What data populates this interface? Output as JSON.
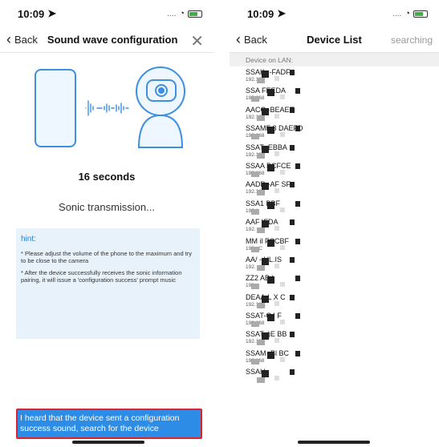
{
  "left": {
    "status": {
      "time": "10:09"
    },
    "nav": {
      "back_label": "Back",
      "title": "Sound wave configuration",
      "close_glyph": "✕"
    },
    "countdown": "16 seconds",
    "status_text": "Sonic transmission...",
    "hint": {
      "title": "hint:",
      "items": [
        "* Please adjust the volume of the phone to the maximum and try to be close to the camera",
        "* After the device successfully receives the sonic information pairing, it will issue a 'configuration success' prompt music"
      ]
    },
    "confirm_button": "I heard that the device sent a configuration success sound, search for the device"
  },
  "right": {
    "status": {
      "time": "10:09"
    },
    "nav": {
      "back_label": "Back",
      "title": "Device List",
      "right_label": "searching"
    },
    "section_header": "Device on LAN:",
    "devices": [
      {
        "name": "SSAK-       -FADF",
        "ip": "192.168"
      },
      {
        "name": "SSA        FEEDA",
        "ip": "192.168"
      },
      {
        "name": "AACC        -BEAEE",
        "ip": "192.168"
      },
      {
        "name": "SSAMF 3      DAEFD",
        "ip": "192.168"
      },
      {
        "name": "SSAT-        EBBA",
        "ip": "192.168"
      },
      {
        "name": "SSAA        BCFCE",
        "ip": "192.168"
      },
      {
        "name": "AADD        -AF SF",
        "ip": "192.16"
      },
      {
        "name": "SSA1         BBF",
        "ip": "192.1"
      },
      {
        "name": "AAF          \\FDA",
        "ip": "192."
      },
      {
        "name": "MM  il      FCCBF",
        "ip": "192.  :C"
      },
      {
        "name": "AA/  -      UL.IS",
        "ip": "192."
      },
      {
        "name": "ZZ2          AB )",
        "ip": "192."
      },
      {
        "name": "DEAA-L        X  C",
        "ip": "192.168."
      },
      {
        "name": "SSAT-C       I  F",
        "ip": "192.168"
      },
      {
        "name": "SSAT-        )E BB",
        "ip": "192.168"
      },
      {
        "name": "SSAM         -Bl BC",
        "ip": "192.168"
      },
      {
        "name": "SSAH-",
        "ip": ""
      }
    ]
  },
  "colors": {
    "accent": "#2d8de6",
    "hint_bg": "#e8f2fb",
    "highlight_border": "#e0212e"
  }
}
